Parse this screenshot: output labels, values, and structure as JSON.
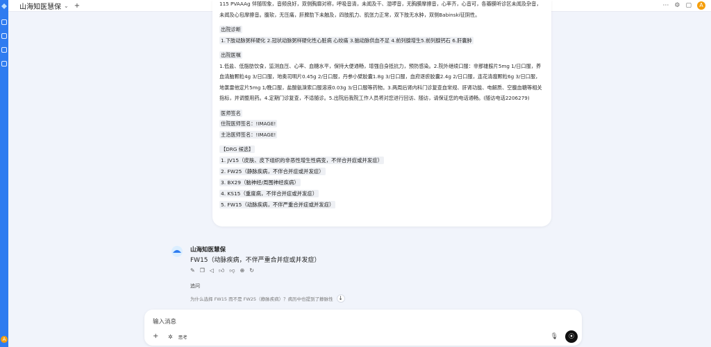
{
  "app": {
    "title": "山海知医慧保",
    "avatar_letter": "A"
  },
  "card": {
    "top_text": "115 PVAAAg 伴随现象，音频良好，双侧胸廓对称，呼吸音清，未闻及干、湿啰音，无胸膜摩擦音，心率齐，心音可，各瓣膜听诊区未闻及杂音，未闻及心包摩擦音。腹软，无压痛，肝脾肋下未触及，四肢肌力、肌张力正常，双下肢无水肿，双侧Babinski征阴性。",
    "diagnosis_heading": "出院诊断",
    "diagnosis_text": "1.下肢动脉粥样硬化 2.冠状动脉粥样硬化性心脏病 心绞痛 3.脑动脉供血不足 4.前列腺增生5.前列腺钙石 6.肝囊肿",
    "advice_heading": "出院医嘱",
    "advice_text": "1.低盐、低脂肪饮食，监测血压、心率、血糖水平，保持大便通畅，增强自身抵抗力，预防感染。2.院外继续口服：非那雄胺片5mg 1/日口服，养血清脑颗粒4g 3/日口服，地奥司明片0.45g 2/日口服，丹参小檗胶囊1.8g 3/日口服，血府逐瘀胶囊2.4g 2/日口服，连花清瘟颗粒6g 3/日口服，地氯雷他定片5mg 1/晚口服，盐酸氨溴索口服溶液0.03g 3/日口服等药物。3.两周后肾内科门诊复查血常规、肝肾功能、电解质、空腹血糖等相关指标，并调整用药。4.定期门诊复查，不适随诊。5.出院后我院工作人员将对您进行回访、随访，请保证您的电话通畅。(随访电话2206279)",
    "doctor_heading": "医师签名",
    "doctor_resident": "住院医师签名：!IMAGE!",
    "doctor_attending": "主治医师签名：!IMAGE!",
    "drg_heading": "【DRG 候选】",
    "drg_items": [
      "1. JV15（皮肤、皮下组织的非恶性增生性病变，不伴合并症或并发症）",
      "2. FW25（静脉疾病，不伴合并症或并发症）",
      "3. BX29（脑神经/周围神经疾病）",
      "4. KS15（重度病，不伴合并症或并发症）",
      "5. FW15（动脉疾病，不伴严重合并症或并发症）"
    ]
  },
  "answer": {
    "name": "山海知医慧保",
    "text": "FW15（动脉疾病，不伴严重合并症或并发症）",
    "follow_label": "追问",
    "suggestion": "为什么选择 FW15 而不是 FW25（静脉疾病）？病历中也提到了静脉性"
  },
  "input": {
    "placeholder": "输入消息",
    "think_label": "思考"
  },
  "icons": {
    "edit": "pencil-icon",
    "copy": "copy-icon",
    "speak": "speaker-icon",
    "like": "thumb-up-icon",
    "dislike": "thumb-down-icon",
    "share": "share-icon",
    "refresh": "refresh-icon"
  },
  "colors": {
    "rail": "#2f7cf0",
    "accent_avatar": "#f59e0b",
    "send": "#111111"
  }
}
